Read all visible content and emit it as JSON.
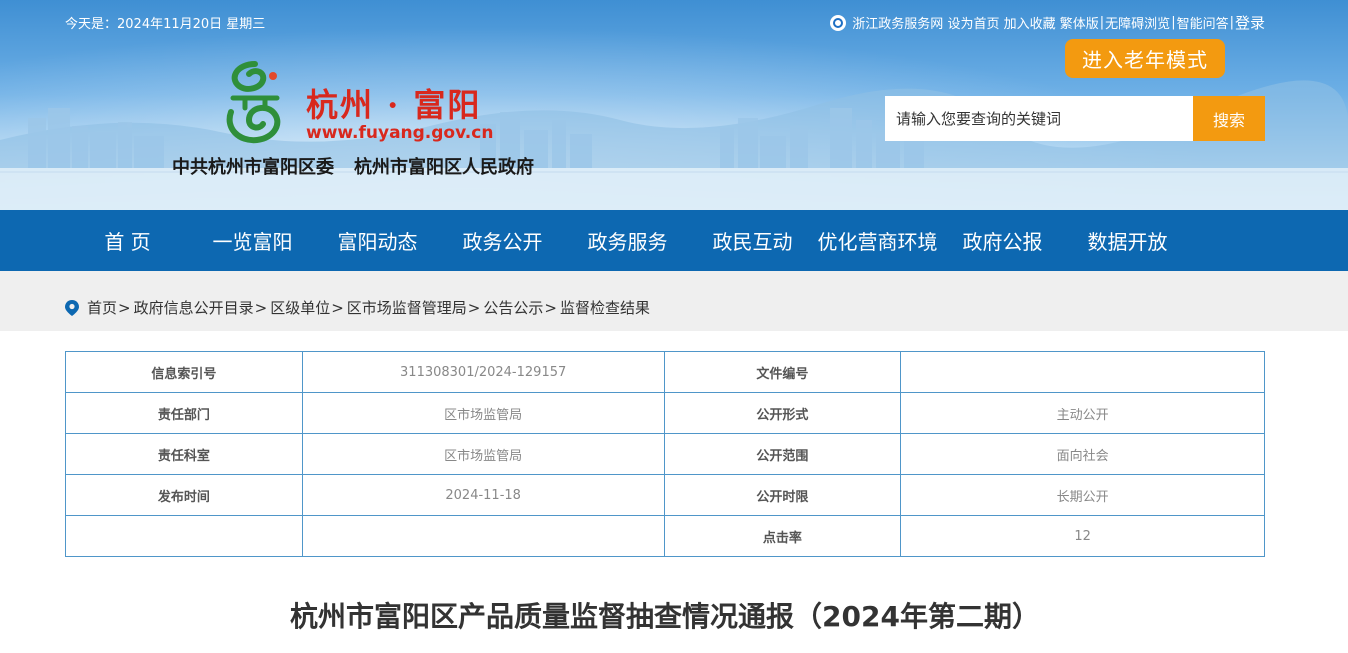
{
  "top": {
    "date": "今天是：2024年11月20日 星期三",
    "links": [
      "浙江政务服务网",
      "设为首页",
      "加入收藏",
      "繁体版",
      "无障碍浏览",
      "智能问答"
    ],
    "login": "登录"
  },
  "header": {
    "elder_mode": "进入老年模式",
    "site_title": "杭州 · 富阳",
    "site_url": "www.fuyang.gov.cn",
    "org_left": "中共杭州市富阳区委",
    "org_right": "杭州市富阳区人民政府",
    "search_placeholder": "请输入您要查询的关键词",
    "search_button": "搜索"
  },
  "nav": [
    "首 页",
    "一览富阳",
    "富阳动态",
    "政务公开",
    "政务服务",
    "政民互动",
    "优化营商环境",
    "政府公报",
    "数据开放"
  ],
  "breadcrumb": [
    "首页",
    "政府信息公开目录",
    "区级单位",
    "区市场监督管理局",
    "公告公示",
    "监督检查结果"
  ],
  "info_table": [
    {
      "k1": "信息索引号",
      "v1": "311308301/2024-129157",
      "k2": "文件编号",
      "v2": ""
    },
    {
      "k1": "责任部门",
      "v1": "区市场监管局",
      "k2": "公开形式",
      "v2": "主动公开"
    },
    {
      "k1": "责任科室",
      "v1": "区市场监管局",
      "k2": "公开范围",
      "v2": "面向社会"
    },
    {
      "k1": "发布时间",
      "v1": "2024-11-18",
      "k2": "公开时限",
      "v2": "长期公开"
    },
    {
      "k1": "",
      "v1": "",
      "k2": "点击率",
      "v2": "12"
    }
  ],
  "article_title": "杭州市富阳区产品质量监督抽查情况通报（2024年第二期）",
  "colors": {
    "nav_bg": "#0d68b1",
    "accent_orange": "#f39a10",
    "title_red": "#d8281d",
    "table_border": "#4f96c9"
  }
}
